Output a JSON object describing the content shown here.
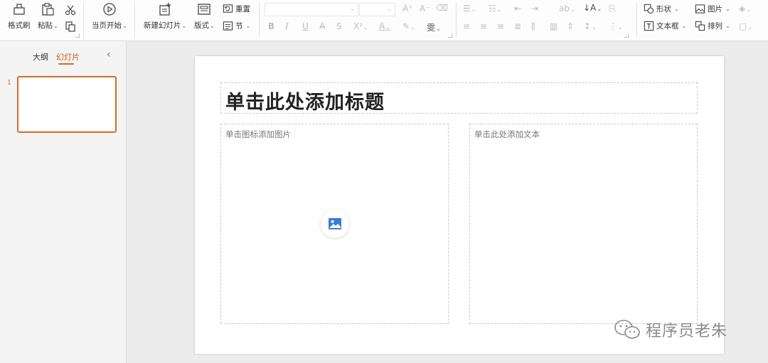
{
  "clipboard": {
    "format_painter": "格式刷",
    "paste": "粘贴"
  },
  "play": {
    "from_current": "当页开始"
  },
  "slides_group": {
    "new_slide": "新建幻灯片",
    "layout": "版式",
    "reset": "重置",
    "section": "节"
  },
  "font": {
    "family_value": "",
    "size_value": ""
  },
  "drawing": {
    "shape": "形状",
    "picture": "图片",
    "textbox": "文本框",
    "arrange": "排列"
  },
  "left_panel": {
    "tabs": [
      "大纲",
      "幻灯片"
    ],
    "active_tab": "幻灯片",
    "slide_number": "1"
  },
  "slide": {
    "title_placeholder": "单击此处添加标题",
    "picture_placeholder": "单击图标添加图片",
    "text_placeholder": "单击此处添加文本"
  },
  "watermark": {
    "text": "程序员老朱"
  },
  "colors": {
    "accent": "#d76a2c",
    "picture_icon": "#3e7bd6"
  }
}
